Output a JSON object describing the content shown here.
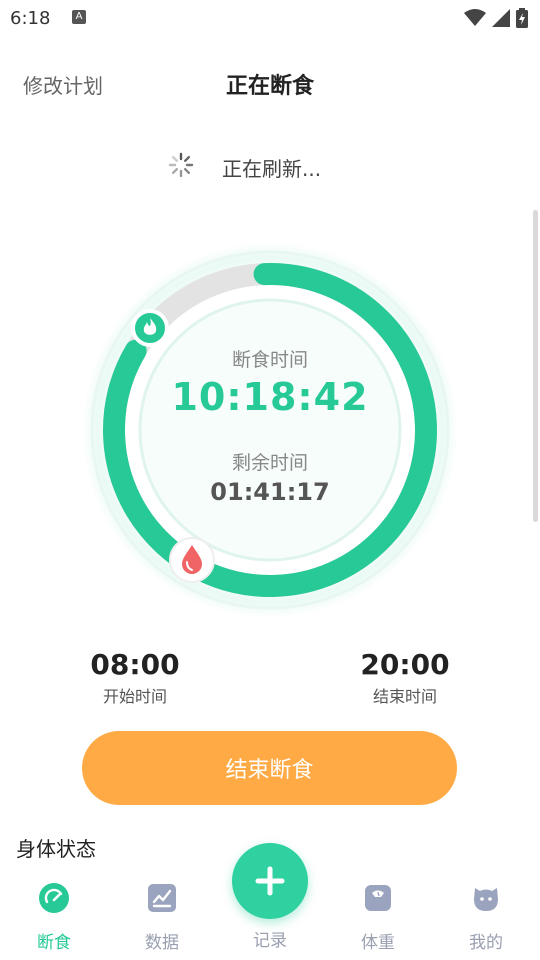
{
  "status_bar": {
    "time": "6:18",
    "notification_icon": "A"
  },
  "header": {
    "left_action": "修改计划",
    "title": "正在断食"
  },
  "refresh": {
    "text": "正在刷新..."
  },
  "timer": {
    "fasting_label": "断食时间",
    "fasting_time": "10:18:42",
    "remaining_label": "剩余时间",
    "remaining_time": "01:41:17",
    "progress_fraction": 0.84,
    "accent_color": "#27c997",
    "track_color": "#e3e3e3"
  },
  "schedule": {
    "start_time": "08:00",
    "start_label": "开始时间",
    "end_time": "20:00",
    "end_label": "结束时间"
  },
  "end_button": {
    "label": "结束断食",
    "color": "#ffaa45"
  },
  "body_status": {
    "title": "身体状态"
  },
  "tabs": [
    {
      "label": "断食",
      "icon": "gauge-icon",
      "active": true
    },
    {
      "label": "数据",
      "icon": "chart-icon",
      "active": false
    },
    {
      "label": "记录",
      "icon": "plus-icon",
      "active": false
    },
    {
      "label": "体重",
      "icon": "scale-icon",
      "active": false
    },
    {
      "label": "我的",
      "icon": "face-icon",
      "active": false
    }
  ]
}
